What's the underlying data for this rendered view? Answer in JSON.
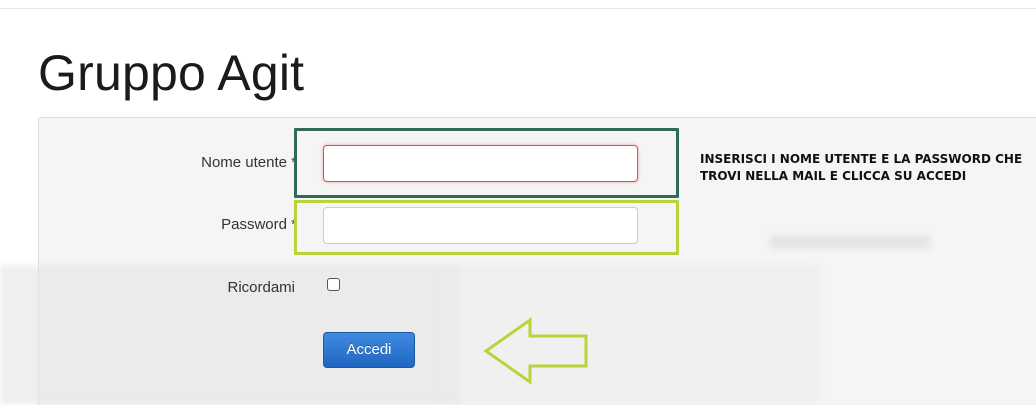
{
  "page": {
    "title": "Gruppo Agit"
  },
  "form": {
    "username_label": "Nome utente *",
    "username_value": "",
    "password_label": "Password *",
    "password_value": "",
    "remember_label": "Ricordami",
    "remember_checked": false,
    "submit_label": "Accedi"
  },
  "annotation": {
    "instruction_text": "INSERISCI I NOME UTENTE E LA PASSWORD CHE TROVI NELLA MAIL E CLICCA SU ACCEDI",
    "username_box_color": "#2f6b55",
    "password_box_color": "#b9d33a",
    "arrow_color": "#b9d33a",
    "arrow_icon": "arrow-left-icon"
  },
  "colors": {
    "button": "#2a74d0",
    "error_border": "#d9534f"
  }
}
